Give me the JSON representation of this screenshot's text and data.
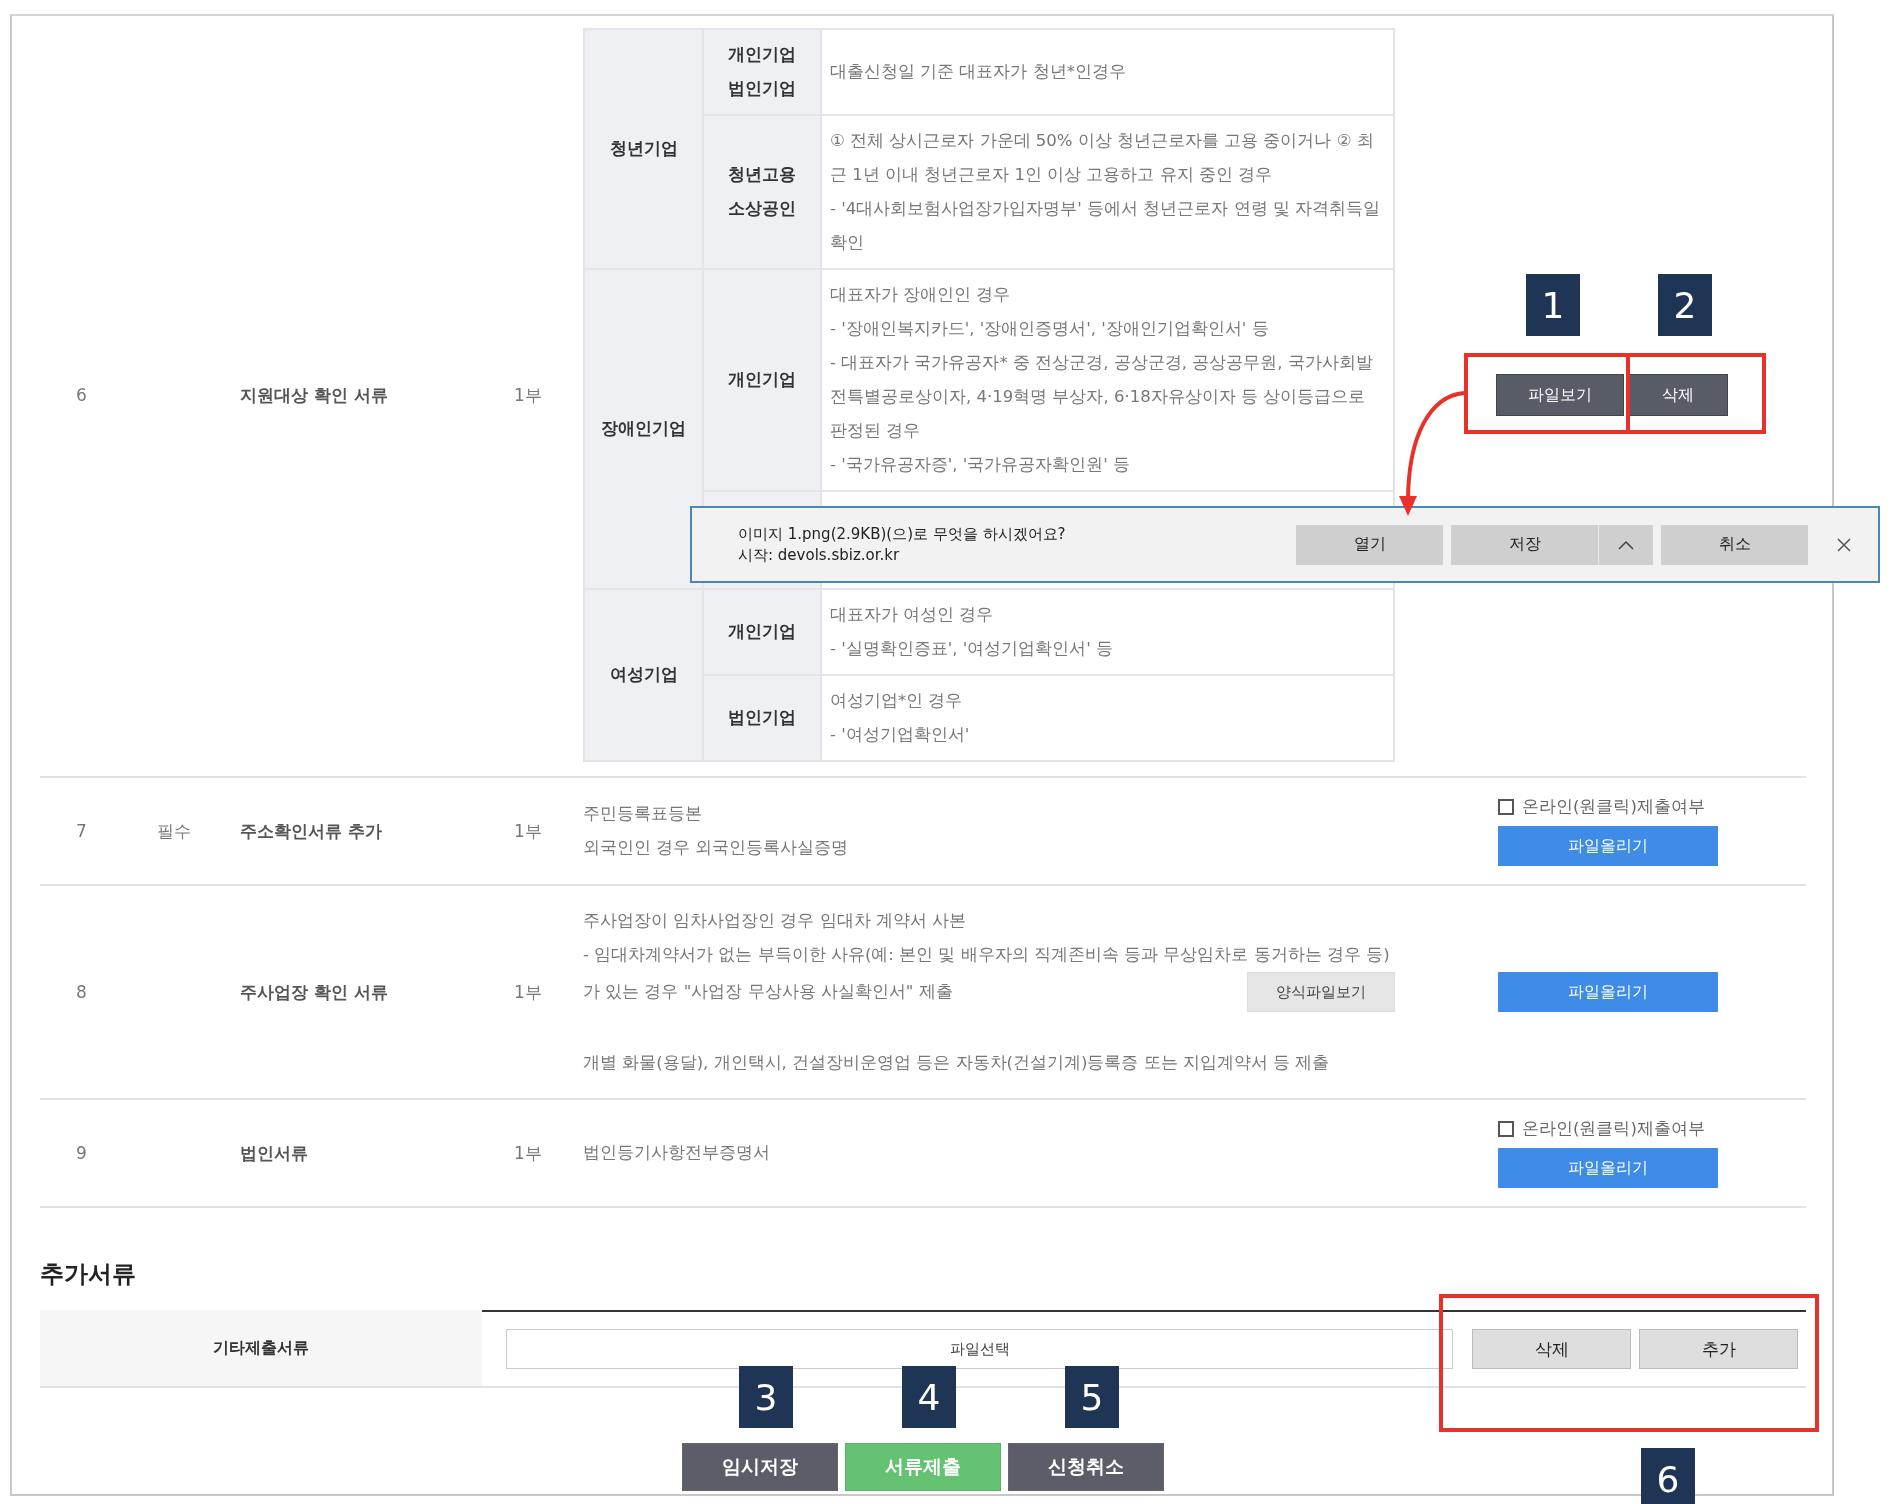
{
  "rows": [
    {
      "number": "6",
      "name": "지원대상 확인 서류",
      "quantity": "1부",
      "kind": "detail_table",
      "detail_groups": [
        {
          "category": "청년기업",
          "subrows": [
            {
              "kind": "text",
              "labels": [
                "개인기업",
                "법인기업"
              ],
              "lines": [
                "대출신청일 기준 대표자가 청년*인경우"
              ]
            },
            {
              "kind": "text",
              "labels": [
                "청년고용",
                "소상공인"
              ],
              "lines": [
                "① 전체 상시근로자 가운데 50% 이상 청년근로자를 고용 중이거나 ② 최근 1년 이내 청년근로자 1인 이상 고용하고 유지 중인 경우",
                "- '4대사회보험사업장가입자명부' 등에서 청년근로자 연령 및 자격취득일 확인"
              ]
            }
          ]
        },
        {
          "category": "장애인기업",
          "subrows": [
            {
              "kind": "text",
              "labels": [
                "개인기업"
              ],
              "lines": [
                "대표자가 장애인인 경우",
                "- '장애인복지카드', '장애인증명서', '장애인기업확인서' 등",
                "- 대표자가 국가유공자* 중 전상군경, 공상군경, 공상공무원, 국가사회발전특별공로상이자, 4·19혁명 부상자, 6·18자유상이자 등 상이등급으로 판정된 경우",
                "- '국가유공자증', '국가유공자확인원' 등"
              ]
            },
            {
              "kind": "obscured"
            }
          ]
        },
        {
          "category": "여성기업",
          "subrows": [
            {
              "kind": "text",
              "labels": [
                "개인기업"
              ],
              "lines": [
                "대표자가 여성인 경우",
                "- '실명확인증표', '여성기업확인서' 등"
              ]
            },
            {
              "kind": "text",
              "labels": [
                "법인기업"
              ],
              "lines": [
                "여성기업*인 경우",
                "- '여성기업확인서'"
              ]
            }
          ]
        }
      ],
      "actions": [
        {
          "kind": "dark_button",
          "label": "파일보기",
          "callout": "1",
          "pointer": true
        },
        {
          "kind": "dark_button",
          "label": "삭제",
          "callout": "2"
        }
      ]
    },
    {
      "number": "7",
      "required": "필수",
      "name": "주소확인서류 추가",
      "quantity": "1부",
      "kind": "lines",
      "lines": [
        "주민등록표등본",
        "외국인인 경우 외국인등록사실증명"
      ],
      "actions": [
        {
          "kind": "checkbox",
          "label": "온라인(원클릭)제출여부",
          "checked": false
        },
        {
          "kind": "upload_button",
          "label": "파일올리기"
        }
      ]
    },
    {
      "number": "8",
      "name": "주사업장 확인 서류",
      "quantity": "1부",
      "kind": "lines",
      "lines": [
        "주사업장이 임차사업장인 경우 임대차 계약서 사본",
        "- 임대차계약서가 없는 부득이한 사유(예: 본인 및 배우자의 직계존비속 등과 무상임차로 동거하는 경우 등)",
        "가 있는 경우 \"사업장 무상사용 사실확인서\" 제출"
      ],
      "form_button": "양식파일보기",
      "note": "개별 화물(용달), 개인택시, 건설장비운영업 등은 자동차(건설기계)등록증 또는 지입계약서 등 제출",
      "actions": [
        {
          "kind": "upload_button",
          "label": "파일올리기"
        }
      ]
    },
    {
      "number": "9",
      "name": "법인서류",
      "quantity": "1부",
      "kind": "lines",
      "lines": [
        "법인등기사항전부증명서"
      ],
      "actions": [
        {
          "kind": "checkbox",
          "label": "온라인(원클릭)제출여부",
          "checked": false
        },
        {
          "kind": "upload_button",
          "label": "파일올리기"
        }
      ]
    }
  ],
  "download_bar": {
    "message": "이미지 1.png(2.9KB)(으)로 무엇을 하시겠어요?",
    "source": "시작: devols.sbiz.or.kr",
    "buttons": [
      {
        "kind": "plain",
        "label": "열기"
      },
      {
        "kind": "split",
        "label": "저장"
      },
      {
        "kind": "plain",
        "label": "취소"
      }
    ]
  },
  "extra_documents": {
    "title": "추가서류",
    "label": "기타제출서류",
    "file_field": {
      "placeholder": "파일선택"
    },
    "buttons": [
      {
        "label": "삭제"
      },
      {
        "label": "추가"
      }
    ],
    "callout": "6"
  },
  "submit_buttons": [
    {
      "kind": "save",
      "label": "임시저장",
      "callout": "3"
    },
    {
      "kind": "submit",
      "label": "서류제출",
      "callout": "4"
    },
    {
      "kind": "cancel",
      "label": "신청취소",
      "callout": "5"
    }
  ]
}
